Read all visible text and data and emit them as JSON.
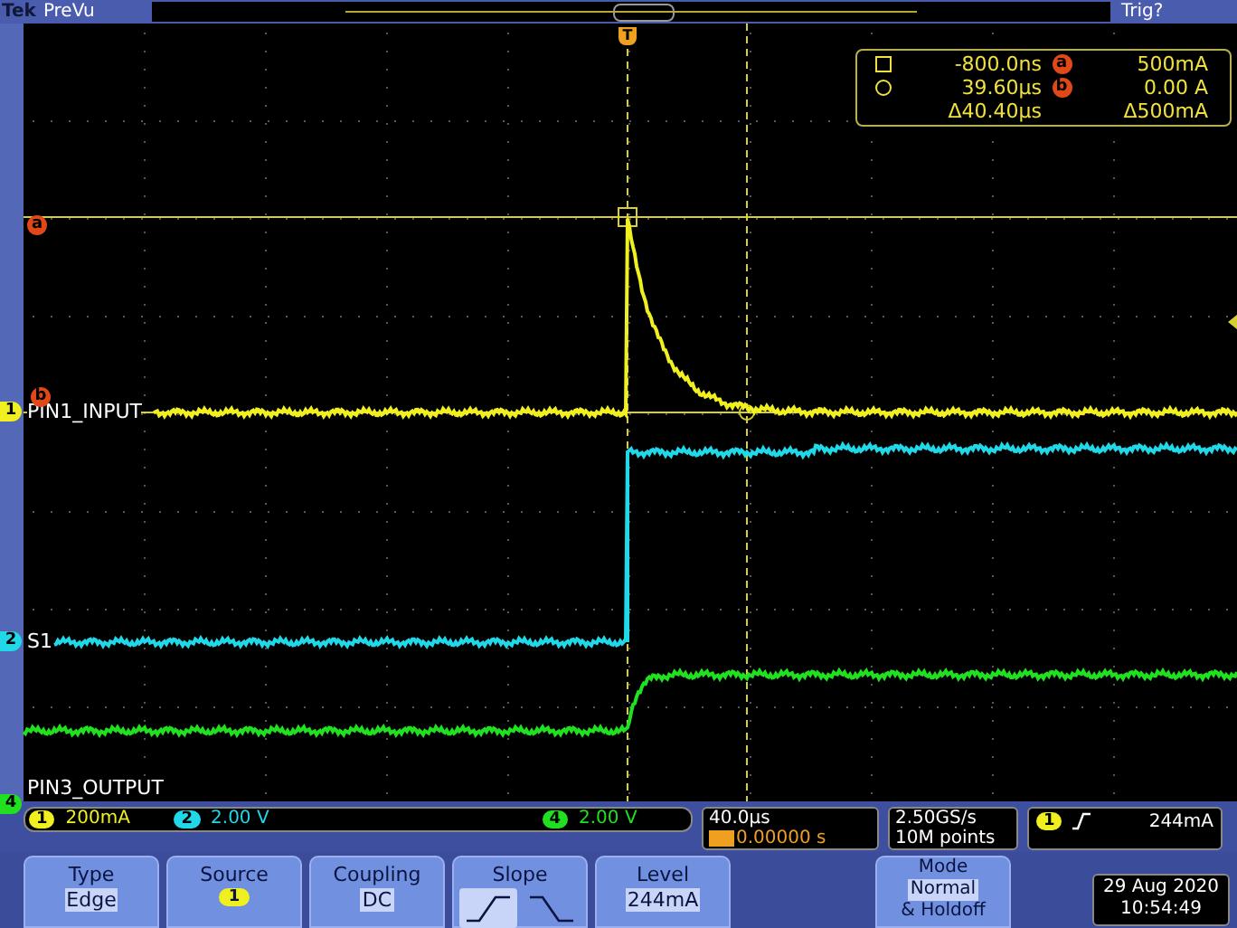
{
  "top_bar": {
    "brand": "Tek",
    "mode": "PreVu",
    "trigger_status": "Trig?"
  },
  "traces": [
    {
      "number": "1",
      "label": "PIN1_INPUT",
      "color": "#f0f020"
    },
    {
      "number": "2",
      "label": "S1",
      "color": "#20d8e8"
    },
    {
      "number": "4",
      "label": "PIN3_OUTPUT",
      "color": "#20e020"
    }
  ],
  "cursor_markers": [
    {
      "label": "a"
    },
    {
      "label": "b"
    }
  ],
  "trigger_marker": "T",
  "cursor_readout": {
    "rows": [
      {
        "kind": "square",
        "time": "-800.0ns",
        "marker": "a",
        "value": "500mA"
      },
      {
        "kind": "circle",
        "time": "39.60µs",
        "marker": "b",
        "value": "0.00 A"
      },
      {
        "time": "Δ40.40µs",
        "value": "Δ500mA"
      }
    ]
  },
  "channel_scales": [
    {
      "number": "1",
      "scale": "200mA",
      "color": "#f0f020"
    },
    {
      "number": "2",
      "scale": "2.00 V",
      "color": "#20d8e8"
    },
    {
      "number": "4",
      "scale": "2.00 V",
      "color": "#20e020"
    }
  ],
  "timebase": {
    "scale": "40.0µs",
    "position": "0.00000 s"
  },
  "acquisition": {
    "sample_rate": "2.50GS/s",
    "record_length": "10M points"
  },
  "trigger": {
    "channel": "1",
    "level": "244mA"
  },
  "menu": [
    {
      "kind": "text",
      "title": "Type",
      "value": "Edge"
    },
    {
      "kind": "badge",
      "title": "Source",
      "value": "1"
    },
    {
      "kind": "text",
      "title": "Coupling",
      "value": "DC"
    },
    {
      "kind": "slope",
      "title": "Slope",
      "options": [
        {
          "kind": "rising",
          "selected": true
        },
        {
          "kind": "falling",
          "selected": false
        }
      ]
    },
    {
      "kind": "text",
      "title": "Level",
      "value": "244mA"
    },
    {
      "kind": "multi",
      "title": "Mode",
      "lines": [
        "Normal",
        "& Holdoff"
      ]
    }
  ],
  "clock": {
    "date": "29 Aug 2020",
    "time": "10:54:49"
  }
}
